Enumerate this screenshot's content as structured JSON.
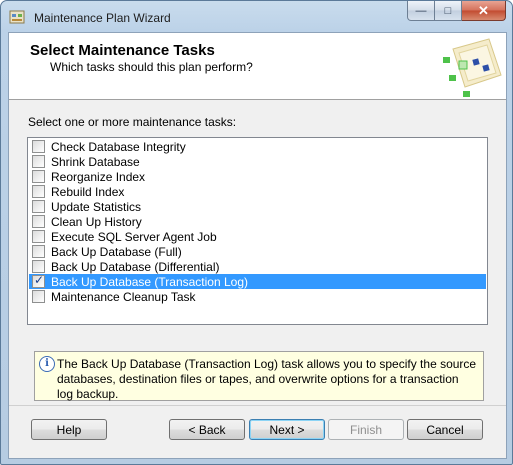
{
  "window": {
    "title": "Maintenance Plan Wizard",
    "minimize_glyph": "—",
    "maximize_glyph": "□",
    "close_glyph": "✕"
  },
  "header": {
    "title": "Select Maintenance Tasks",
    "subtitle": "Which tasks should this plan perform?"
  },
  "tasks_label": "Select one or more maintenance tasks:",
  "tasks": [
    {
      "label": "Check Database Integrity",
      "checked": false
    },
    {
      "label": "Shrink Database",
      "checked": false
    },
    {
      "label": "Reorganize Index",
      "checked": false
    },
    {
      "label": "Rebuild Index",
      "checked": false
    },
    {
      "label": "Update Statistics",
      "checked": false
    },
    {
      "label": "Clean Up History",
      "checked": false
    },
    {
      "label": "Execute SQL Server Agent Job",
      "checked": false
    },
    {
      "label": "Back Up Database (Full)",
      "checked": false
    },
    {
      "label": "Back Up Database (Differential)",
      "checked": false
    },
    {
      "label": "Back Up Database (Transaction Log)",
      "checked": true,
      "selected": true
    },
    {
      "label": "Maintenance Cleanup Task",
      "checked": false
    }
  ],
  "checkmark_glyph": "✓",
  "info": {
    "icon_glyph": "i",
    "text": "The Back Up Database (Transaction Log) task allows you to specify the source databases, destination files or tapes, and overwrite options for a transaction log backup."
  },
  "buttons": {
    "help": "Help",
    "back": "< Back",
    "next": "Next >",
    "finish": "Finish",
    "cancel": "Cancel"
  },
  "colors": {
    "selection": "#3399ff",
    "info_background": "#ffffe1",
    "close_button": "#c24b30"
  }
}
